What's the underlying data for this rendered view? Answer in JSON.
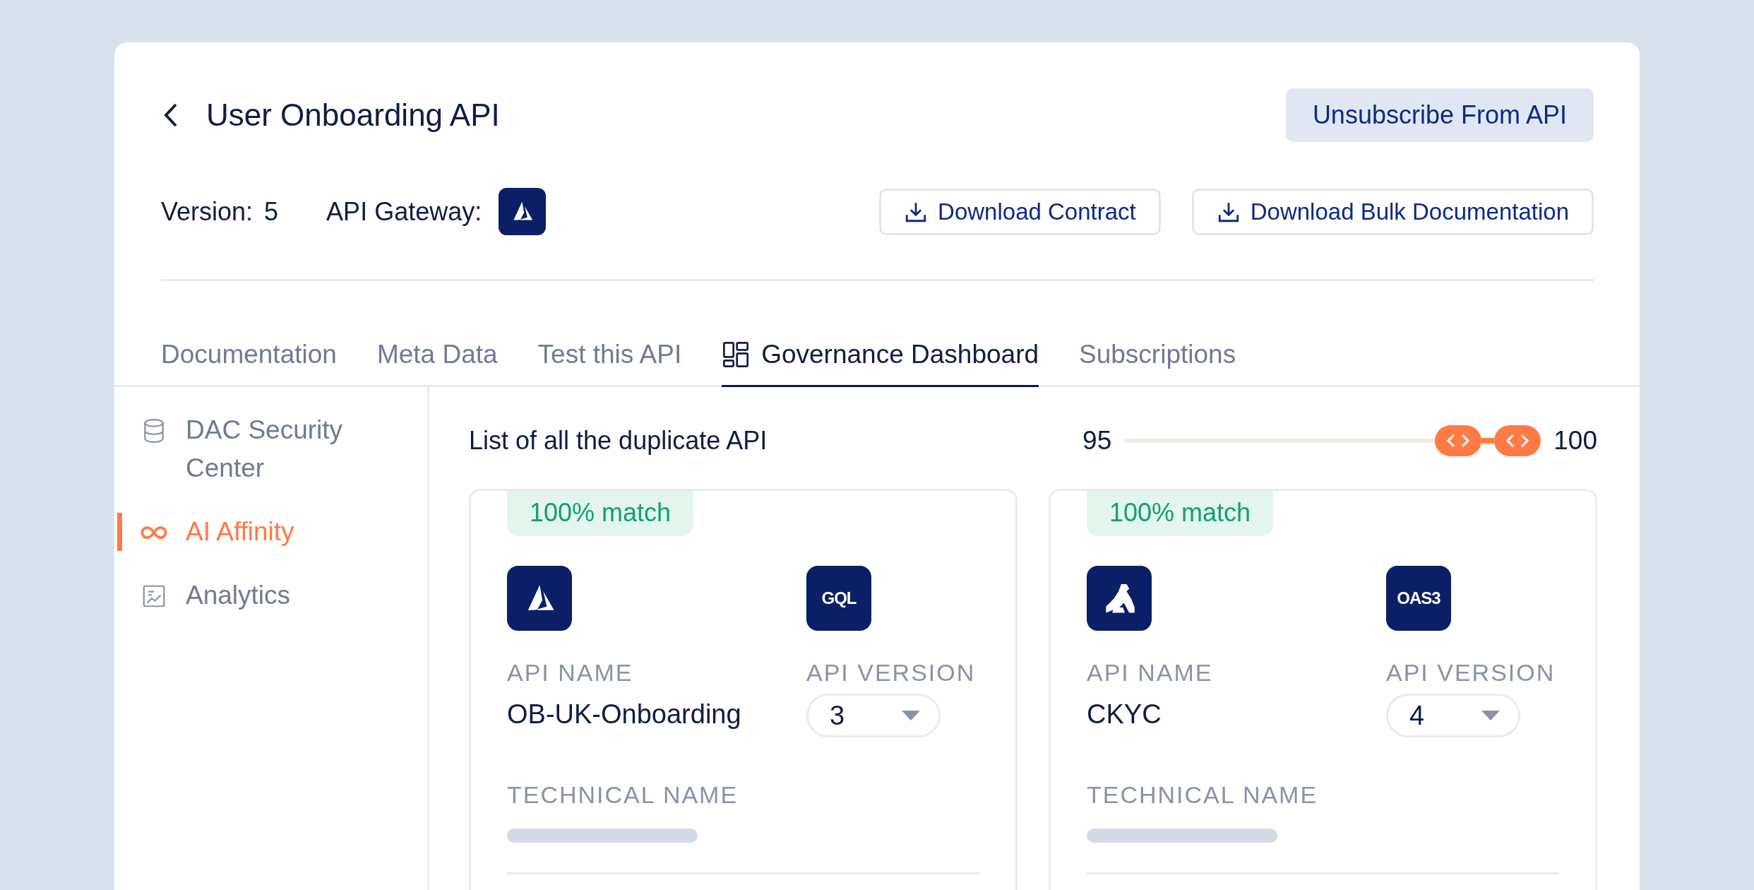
{
  "header": {
    "title": "User Onboarding API",
    "action": "Unsubscribe From API",
    "version_label": "Version:",
    "version": "5",
    "gateway_label": "API Gateway:",
    "gateway": {
      "kind": "triangle"
    },
    "downloads": [
      "Download Contract",
      "Download Bulk Documentation"
    ]
  },
  "tabs": [
    {
      "label": "Documentation",
      "selected": false
    },
    {
      "label": "Meta Data",
      "selected": false
    },
    {
      "label": "Test this API",
      "selected": false
    },
    {
      "label": "Governance Dashboard",
      "selected": true
    },
    {
      "label": "Subscriptions",
      "selected": false
    }
  ],
  "sidebar": {
    "items": [
      {
        "label": "DAC Security Center",
        "kind": "database",
        "selected": false
      },
      {
        "label": "AI Affinity",
        "kind": "infinity",
        "selected": true
      },
      {
        "label": "Analytics",
        "kind": "chart",
        "selected": false
      }
    ]
  },
  "content": {
    "title": "List of all the duplicate API",
    "slider": {
      "min_label": "95",
      "max_label": "100",
      "thumbs": [
        {
          "level": 0.84
        },
        {
          "level": 1
        }
      ]
    },
    "cards": [
      {
        "match": "100% match",
        "gateway": {
          "kind": "triangle"
        },
        "spec_badge": "GQL",
        "name_label": "API NAME",
        "name": "OB-UK-Onboarding",
        "version_label": "API VERSION",
        "version": "3",
        "technical_label": "TECHNICAL NAME"
      },
      {
        "match": "100% match",
        "gateway": {
          "kind": "blocks"
        },
        "spec_badge": "OAS3",
        "name_label": "API NAME",
        "name": "CKYC",
        "version_label": "API VERSION",
        "version": "4",
        "technical_label": "TECHNICAL NAME"
      }
    ]
  }
}
